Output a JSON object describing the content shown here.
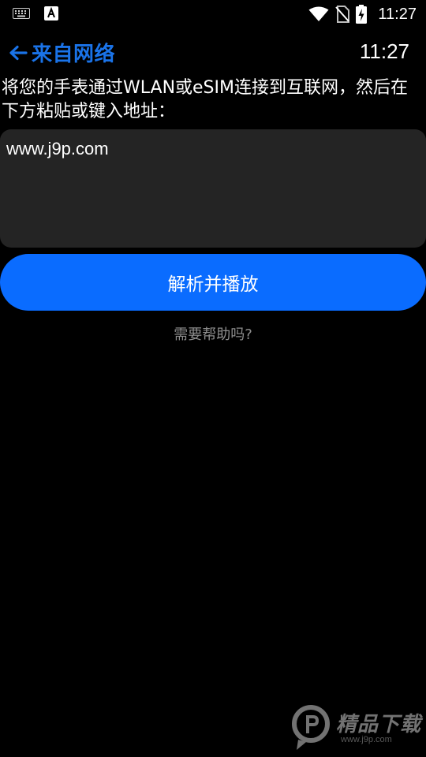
{
  "status_bar": {
    "time": "11:27",
    "left_icons": [
      "keyboard-icon",
      "text-a-icon"
    ],
    "right_icons": [
      "wifi-icon",
      "no-sim-icon",
      "battery-charging-icon"
    ]
  },
  "header": {
    "back_icon": "arrow-left-icon",
    "title": "来自网络",
    "time": "11:27"
  },
  "instruction": "将您的手表通过WLAN或eSIM连接到互联网，然后在下方粘贴或键入地址：",
  "url_input": {
    "value": "www.j9p.com",
    "placeholder": ""
  },
  "parse_button": {
    "label": "解析并播放"
  },
  "help_link": {
    "label": "需要帮助吗?"
  },
  "watermark": {
    "text": "精品下载",
    "subtext": "www.j9p.com"
  },
  "colors": {
    "background": "#000000",
    "accent": "#1a73e8",
    "button": "#0a6cff",
    "input_bg": "#242424",
    "muted_text": "#8e8e8e"
  }
}
